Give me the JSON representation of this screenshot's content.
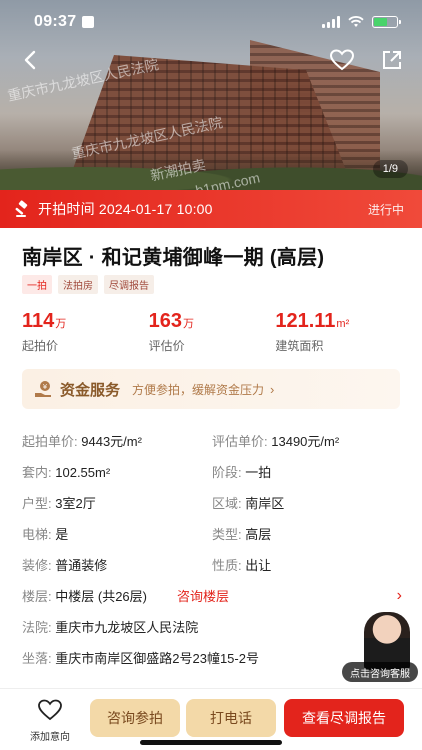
{
  "status_bar": {
    "time": "09:37"
  },
  "hero": {
    "watermark_lines": [
      "重庆市九龙坡区人民法院",
      "重庆市九龙坡区人民法院",
      "新潮拍卖",
      "b1pm.com"
    ],
    "image_counter": "1/9"
  },
  "auction": {
    "label": "开拍时间 2024-01-17 10:00",
    "status": "进行中"
  },
  "title": "南岸区 · 和记黄埔御峰一期 (高层)",
  "tags": [
    "一拍",
    "法拍房",
    "尽调报告"
  ],
  "stats": [
    {
      "num": "114",
      "unit": "万",
      "label": "起拍价"
    },
    {
      "num": "163",
      "unit": "万",
      "label": "评估价"
    },
    {
      "num": "121.11",
      "unit": "m²",
      "label": "建筑面积"
    }
  ],
  "fund_service": {
    "title": "资金服务",
    "subtitle": "方便参拍，缓解资金压力"
  },
  "details": {
    "row1": {
      "k1": "起拍单价:",
      "v1": "9443元/m²",
      "k2": "评估单价:",
      "v2": "13490元/m²"
    },
    "row2": {
      "k1": "套内:",
      "v1": "102.55m²",
      "k2": "阶段:",
      "v2": "一拍"
    },
    "row3": {
      "k1": "户型:",
      "v1": "3室2厅",
      "k2": "区域:",
      "v2": "南岸区"
    },
    "row4": {
      "k1": "电梯:",
      "v1": "是",
      "k2": "类型:",
      "v2": "高层"
    },
    "row5": {
      "k1": "装修:",
      "v1": "普通装修",
      "k2": "性质:",
      "v2": "出让"
    },
    "floor": {
      "k": "楼层:",
      "v": "中楼层 (共26层)",
      "link": "咨询楼层"
    },
    "court": {
      "k": "法院:",
      "v": "重庆市九龙坡区人民法院"
    },
    "address": {
      "k": "坐落:",
      "v": "重庆市南岸区御盛路2号23幢15-2号"
    }
  },
  "agent": {
    "label": "点击咨询客服"
  },
  "bottom_bar": {
    "favorite": "添加意向",
    "consult": "咨询参拍",
    "call": "打电话",
    "report": "查看尽调报告"
  },
  "colors": {
    "accent": "#e3241c",
    "gold": "#f3d9a8"
  }
}
